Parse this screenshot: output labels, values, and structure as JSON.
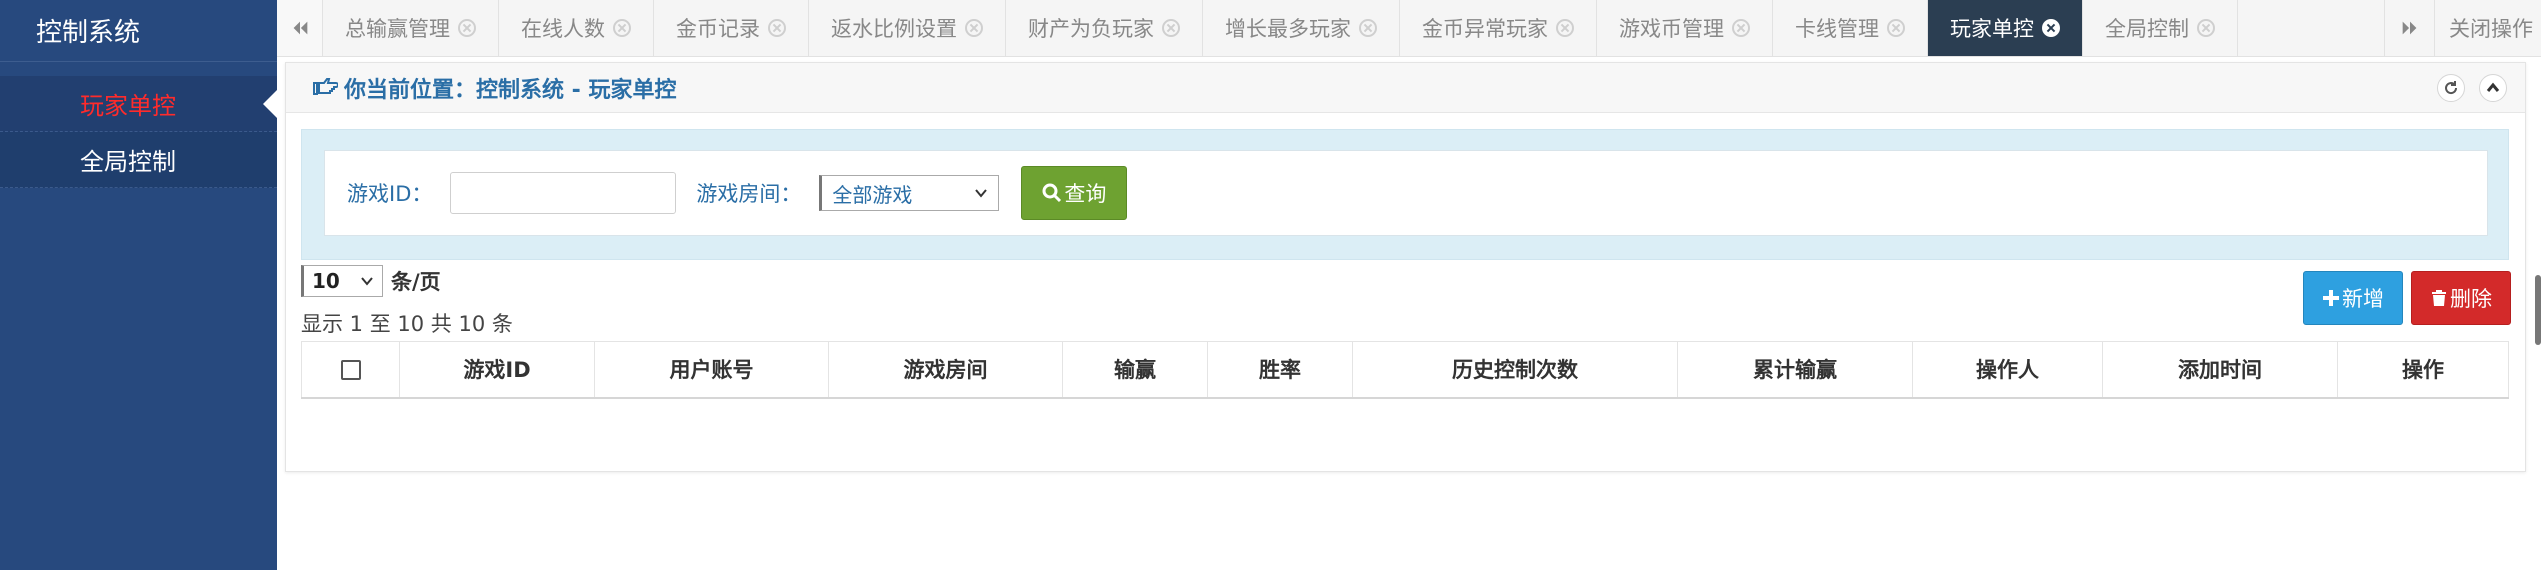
{
  "sidebar": {
    "title": "控制系统",
    "items": [
      {
        "label": "玩家单控",
        "active": true
      },
      {
        "label": "全局控制",
        "active": false
      }
    ]
  },
  "tabbar": {
    "prev_icon": "double-chevron-left-icon",
    "next_icon": "double-chevron-right-icon",
    "tabs": [
      {
        "label": "总输赢管理"
      },
      {
        "label": "在线人数"
      },
      {
        "label": "金币记录"
      },
      {
        "label": "返水比例设置"
      },
      {
        "label": "财产为负玩家"
      },
      {
        "label": "增长最多玩家"
      },
      {
        "label": "金币异常玩家"
      },
      {
        "label": "游戏币管理"
      },
      {
        "label": "卡线管理"
      },
      {
        "label": "玩家单控",
        "active": true
      },
      {
        "label": "全局控制"
      }
    ],
    "close_ops_label": "关闭操作"
  },
  "panel": {
    "breadcrumb": "你当前位置：控制系统 - 玩家单控",
    "refresh_icon": "refresh-icon",
    "collapse_icon": "chevron-up-icon"
  },
  "search": {
    "game_id_label": "游戏ID：",
    "game_id_value": "",
    "room_label": "游戏房间：",
    "room_selected": "全部游戏",
    "query_label": "查询"
  },
  "listing": {
    "page_size": "10",
    "per_page_label": "条/页",
    "info": "显示 1 至 10 共 10 条",
    "add_label": "新增",
    "delete_label": "删除"
  },
  "table": {
    "headers": [
      "游戏ID",
      "用户账号",
      "游戏房间",
      "输赢",
      "胜率",
      "历史控制次数",
      "累计输赢",
      "操作人",
      "添加时间",
      "操作"
    ]
  },
  "colors": {
    "sidebar_bg": "#27497e",
    "active_tab_bg": "#2b3e52",
    "accent_blue": "#2a6ea6",
    "active_menu_text": "#ff2b2b",
    "query_green": "#6ea231",
    "add_blue": "#2ea0e0",
    "delete_red": "#d32a2a"
  }
}
